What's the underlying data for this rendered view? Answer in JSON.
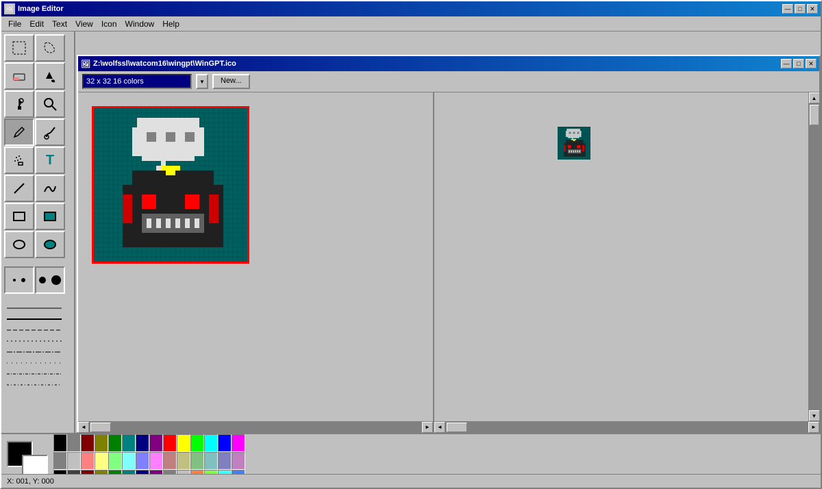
{
  "app": {
    "title": "Image Editor",
    "icon": "🖼"
  },
  "title_controls": {
    "minimize": "—",
    "maximize": "□",
    "close": "✕"
  },
  "menu": {
    "items": [
      "File",
      "Edit",
      "Text",
      "View",
      "Icon",
      "Window",
      "Help"
    ]
  },
  "inner_window": {
    "title": "Z:\\wolfssl\\watcom16\\wingpt\\WinGPT.ico",
    "icon": "🖼"
  },
  "toolbar": {
    "size_label": "32 x 32  16 colors",
    "new_button": "New..."
  },
  "tools": [
    {
      "name": "select-rect",
      "icon": "⬚"
    },
    {
      "name": "select-free",
      "icon": "⤶"
    },
    {
      "name": "eraser",
      "icon": "◻"
    },
    {
      "name": "fill",
      "icon": "🪣"
    },
    {
      "name": "eyedropper",
      "icon": "💧"
    },
    {
      "name": "magnify",
      "icon": "🔍"
    },
    {
      "name": "pencil",
      "icon": "✏"
    },
    {
      "name": "brush",
      "icon": "🖌"
    },
    {
      "name": "spray",
      "icon": "·"
    },
    {
      "name": "text",
      "icon": "T"
    },
    {
      "name": "line",
      "icon": "/"
    },
    {
      "name": "curve",
      "icon": "∿"
    },
    {
      "name": "rect",
      "icon": "□"
    },
    {
      "name": "rect-fill",
      "icon": "■"
    },
    {
      "name": "ellipse",
      "icon": "○"
    },
    {
      "name": "ellipse-fill",
      "icon": "●"
    }
  ],
  "status": {
    "coords": "X: 001, Y: 000"
  },
  "colors": {
    "foreground": "#000000",
    "background": "#ffffff",
    "swatches": [
      "#000000",
      "#808080",
      "#800000",
      "#808000",
      "#008000",
      "#008080",
      "#000080",
      "#800080",
      "#ffffff",
      "#c0c0c0",
      "#ff0000",
      "#ffff00",
      "#00ff00",
      "#00ffff",
      "#0000ff",
      "#ff00ff",
      "#000000",
      "#404040",
      "#800000",
      "#804000",
      "#408000",
      "#004040",
      "#000040",
      "#400040",
      "#808080",
      "#c0c0c0",
      "#ff8080",
      "#ffff80",
      "#80ff80",
      "#80ffff",
      "#8080ff",
      "#ff80ff",
      "#c0c0c0",
      "#e0e0e0",
      "#ff4040",
      "#c0c000",
      "#00c000",
      "#00c0c0",
      "#0040c0",
      "#c000c0"
    ]
  }
}
